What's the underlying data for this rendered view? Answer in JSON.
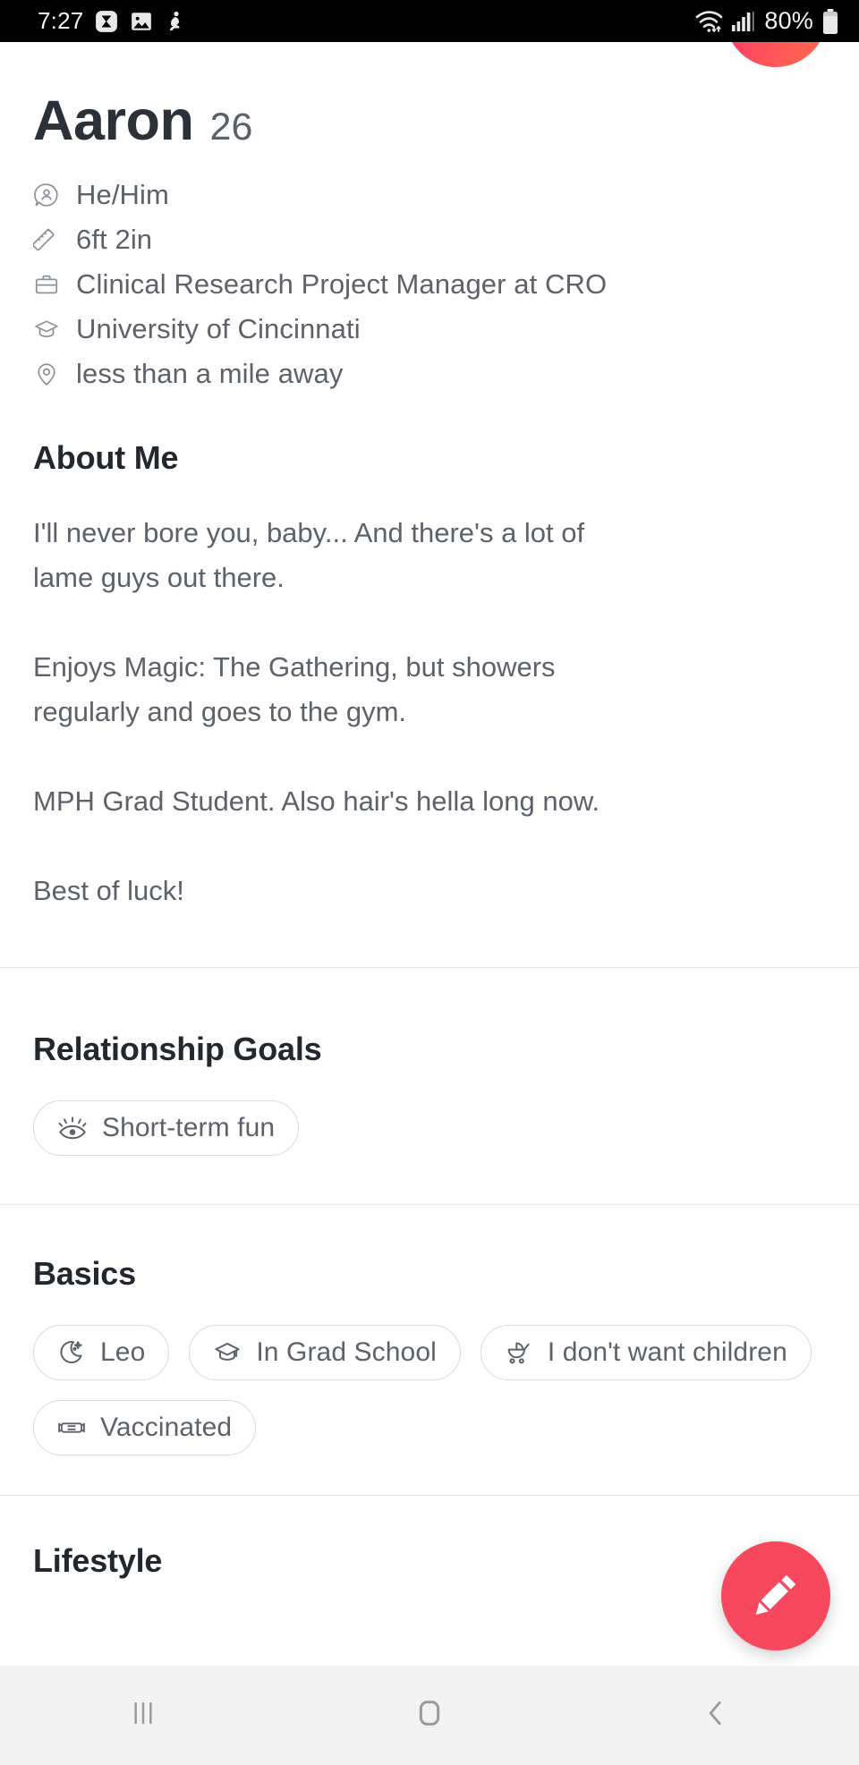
{
  "status_bar": {
    "time": "7:27",
    "battery_percent": "80%",
    "left_icons": [
      "sigma-icon",
      "image-icon",
      "person-activity-icon"
    ],
    "right_icons": [
      "wifi-icon",
      "cellular-signal-icon",
      "battery-icon"
    ]
  },
  "badge": {
    "name": "heart-badge",
    "gradient_from": "#FF2D6F",
    "gradient_to": "#FF6B4A"
  },
  "profile": {
    "name": "Aaron",
    "age": "26",
    "details": [
      {
        "icon": "pronouns-icon",
        "text": "He/Him"
      },
      {
        "icon": "ruler-icon",
        "text": "6ft 2in"
      },
      {
        "icon": "briefcase-icon",
        "text": "Clinical Research Project Manager at CRO"
      },
      {
        "icon": "graduation-cap-icon",
        "text": "University of Cincinnati"
      },
      {
        "icon": "location-pin-icon",
        "text": "less than a mile away"
      }
    ]
  },
  "about": {
    "title": "About Me",
    "paragraphs": [
      "I'll never bore you, baby... And there's a lot of lame guys out there.",
      "Enjoys Magic: The Gathering, but showers regularly and goes to the gym.",
      "MPH Grad Student. Also hair's hella long now.",
      "Best of luck!"
    ]
  },
  "relationship_goals": {
    "title": "Relationship Goals",
    "chips": [
      {
        "icon": "eye-icon",
        "label": "Short-term fun"
      }
    ]
  },
  "basics": {
    "title": "Basics",
    "chips": [
      {
        "icon": "moon-stars-icon",
        "label": "Leo"
      },
      {
        "icon": "graduation-cap-icon",
        "label": "In Grad School"
      },
      {
        "icon": "stroller-icon",
        "label": "I don't want children"
      },
      {
        "icon": "face-mask-icon",
        "label": "Vaccinated"
      }
    ]
  },
  "lifestyle": {
    "title": "Lifestyle"
  },
  "edit_button": {
    "label": "Edit profile",
    "icon": "pencil-icon",
    "color": "#F8485E"
  },
  "nav_bar": {
    "buttons": [
      {
        "name": "recents",
        "icon": "recents-icon"
      },
      {
        "name": "home",
        "icon": "home-icon"
      },
      {
        "name": "back",
        "icon": "back-icon"
      }
    ]
  }
}
